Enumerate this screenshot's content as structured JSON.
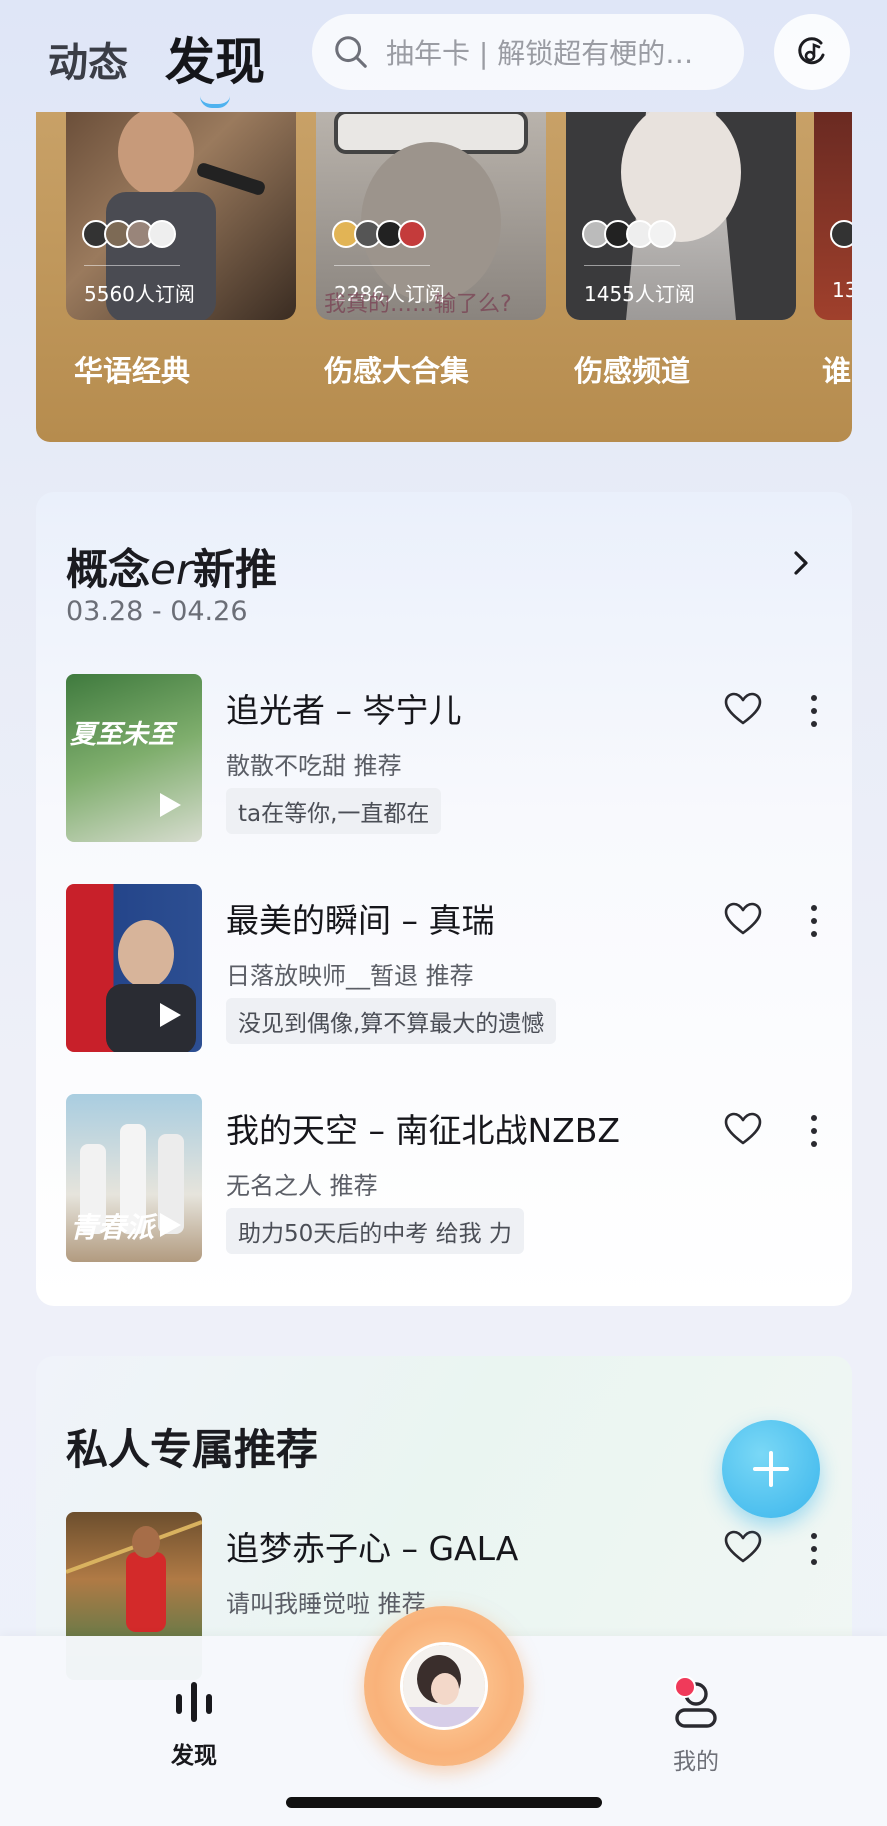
{
  "header": {
    "tab_dynamic": "动态",
    "tab_discover": "发现",
    "search_placeholder": "抽年卡 | 解锁超有梗的…",
    "accent_color": "#4fb2ef"
  },
  "playlists": [
    {
      "subscribers": "5560人订阅",
      "title": "华语经典"
    },
    {
      "subscribers": "2286人订阅",
      "title": "伤感大合集",
      "cover_caption": "我真的……输了么?"
    },
    {
      "subscribers": "1455人订阅",
      "title": "伤感频道"
    },
    {
      "subscribers": "13",
      "title": "谁"
    }
  ],
  "section1": {
    "title_prefix": "概念",
    "title_er": "er",
    "title_suffix": "新推",
    "date_range": "03.28 - 04.26",
    "songs": [
      {
        "title": "追光者 – 岑宁儿",
        "recommender": "散散不吃甜 推荐",
        "tag": "ta在等你,一直都在",
        "cover_text": "夏至未至"
      },
      {
        "title": "最美的瞬间 – 真瑞",
        "recommender": "日落放映师__暂退 推荐",
        "tag": "没见到偶像,算不算最大的遗憾",
        "cover_text": ""
      },
      {
        "title": "我的天空 – 南征北战NZBZ",
        "recommender": "无名之人 推荐",
        "tag": "助力50天后的中考  给我  力",
        "cover_text": "青春派"
      }
    ]
  },
  "section2": {
    "title": "私人专属推荐",
    "songs": [
      {
        "title": "追梦赤子心 – GALA",
        "recommender": "请叫我睡觉啦 推荐"
      }
    ]
  },
  "bottom_nav": {
    "discover": "发现",
    "mine": "我的"
  }
}
